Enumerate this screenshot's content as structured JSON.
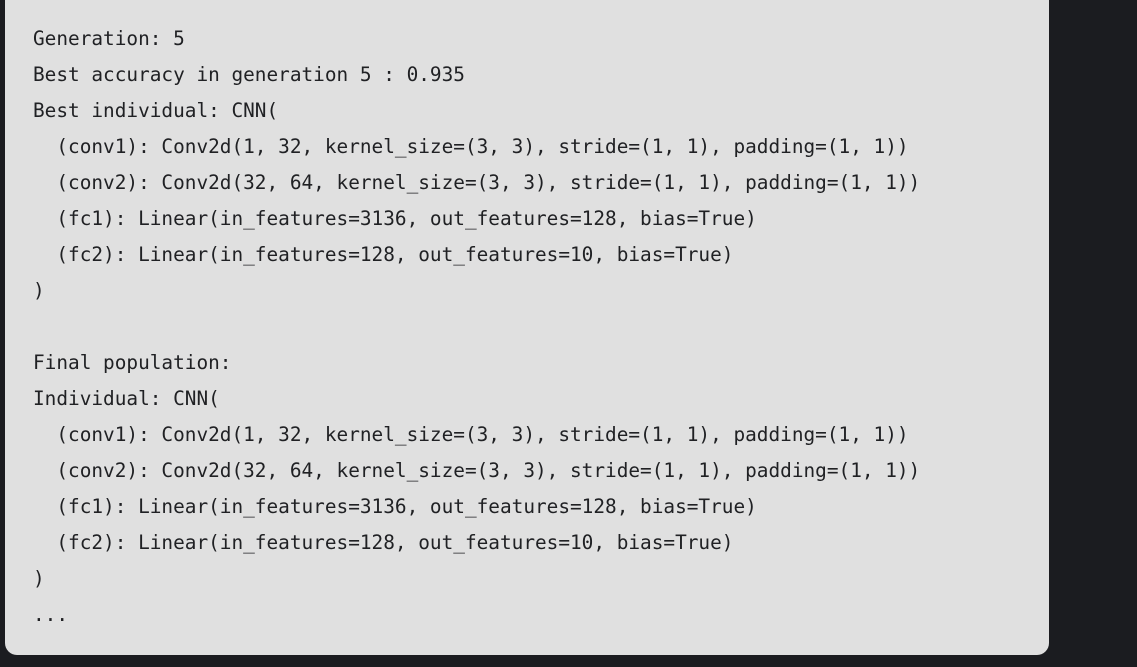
{
  "output": {
    "lines": [
      "Generation: 5",
      "Best accuracy in generation 5 : 0.935",
      "Best individual: CNN(",
      "  (conv1): Conv2d(1, 32, kernel_size=(3, 3), stride=(1, 1), padding=(1, 1))",
      "  (conv2): Conv2d(32, 64, kernel_size=(3, 3), stride=(1, 1), padding=(1, 1))",
      "  (fc1): Linear(in_features=3136, out_features=128, bias=True)",
      "  (fc2): Linear(in_features=128, out_features=10, bias=True)",
      ")",
      "",
      "Final population:",
      "Individual: CNN(",
      "  (conv1): Conv2d(1, 32, kernel_size=(3, 3), stride=(1, 1), padding=(1, 1))",
      "  (conv2): Conv2d(32, 64, kernel_size=(3, 3), stride=(1, 1), padding=(1, 1))",
      "  (fc1): Linear(in_features=3136, out_features=128, bias=True)",
      "  (fc2): Linear(in_features=128, out_features=10, bias=True)",
      ")",
      "..."
    ]
  },
  "colors": {
    "background": "#1b1c20",
    "panel": "#e0e0e0",
    "text": "#202124"
  }
}
